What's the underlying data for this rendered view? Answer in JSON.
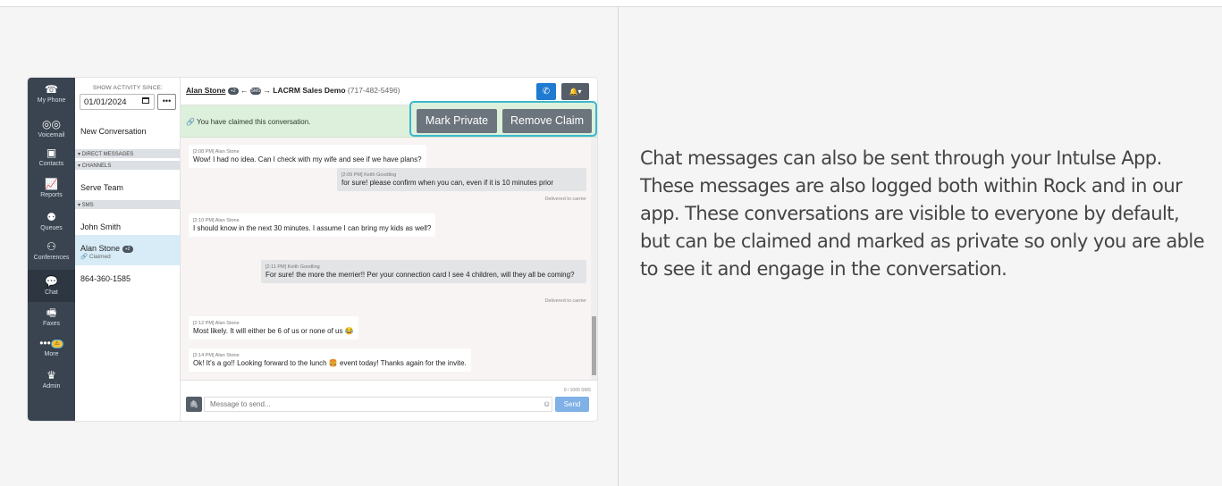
{
  "rail": {
    "items": [
      {
        "icon": "phone-icon",
        "glyph": "☎",
        "label": "My Phone"
      },
      {
        "icon": "voicemail-icon",
        "glyph": "◎◎",
        "label": "Voicemail"
      },
      {
        "icon": "contacts-icon",
        "glyph": "▣",
        "label": "Contacts"
      },
      {
        "icon": "reports-icon",
        "glyph": "📈",
        "label": "Reports"
      },
      {
        "icon": "queues-icon",
        "glyph": "⚉",
        "label": "Queues"
      },
      {
        "icon": "conferences-icon",
        "glyph": "⚇",
        "label": "Conferences"
      },
      {
        "icon": "chat-icon",
        "glyph": "💬",
        "label": "Chat"
      },
      {
        "icon": "fax-icon",
        "glyph": "🖷",
        "label": "Faxes"
      },
      {
        "icon": "more-icon",
        "glyph": "•••",
        "label": "More"
      },
      {
        "icon": "crown-icon",
        "glyph": "♛",
        "label": "Admin"
      }
    ],
    "active": "Chat"
  },
  "conv": {
    "activity_label": "SHOW ACTIVITY SINCE:",
    "date_value": "01/01/2024",
    "dots": "•••",
    "new_conversation": "New Conversation",
    "direct_messages": "▾ DIRECT MESSAGES",
    "channels": "▾ CHANNELS",
    "serve_team": "Serve Team",
    "sms": "▾ SMS",
    "john_smith": "John Smith",
    "alan_stone": "Alan Stone",
    "alan_badge": "+2",
    "claimed": "Claimed",
    "phone_number": "864-360-1585"
  },
  "chat": {
    "title_name": "Alan Stone",
    "title_badge": "+2",
    "arrow_left": "←",
    "sms_badge": "SMS",
    "arrow_right": "→",
    "title_target": "LACRM Sales Demo",
    "title_phone": "(717-482-5496)",
    "claim_message": "You have claimed this conversation.",
    "mark_private": "Mark Private",
    "remove_claim": "Remove Claim"
  },
  "messages": [
    {
      "meta": "[2:08 PM] Alan Stone",
      "text": "Wow! I had no idea. Can I check with my wife and see if we have plans?"
    },
    {
      "meta": "[2:09 PM] Keith Goodling",
      "text": "for sure! please confirm when you can, even if it is 10 minutes prior"
    },
    {
      "meta": "[2:10 PM] Alan Stone",
      "text": "I should know in the next 30 minutes. I assume I can bring my kids as well?"
    },
    {
      "meta": "[2:11 PM] Keith Goodling",
      "text": "For sure! the more the merrier!! Per your connection card I see 4 children, will they all be coming?"
    },
    {
      "meta": "[2:12 PM] Alan Stone",
      "text": "Most likely. It will either be 6 of us or none of us 😂"
    },
    {
      "meta": "[2:14 PM] Alan Stone",
      "text": "Ok! It's a go!! Looking forward to the lunch 🍔 event today! Thanks again for the invite."
    }
  ],
  "delivered_label": "Delivered to carrier",
  "composer": {
    "sms_count": "0 / 1000 SMS",
    "placeholder": "Message to send...",
    "send": "Send"
  },
  "description": "Chat messages can also be sent through your Intulse App. These messages are also logged both within Rock and in our app. These conversations are visible to everyone by default, but can be claimed and marked as private so only you are able to see it and engage in the conversation."
}
